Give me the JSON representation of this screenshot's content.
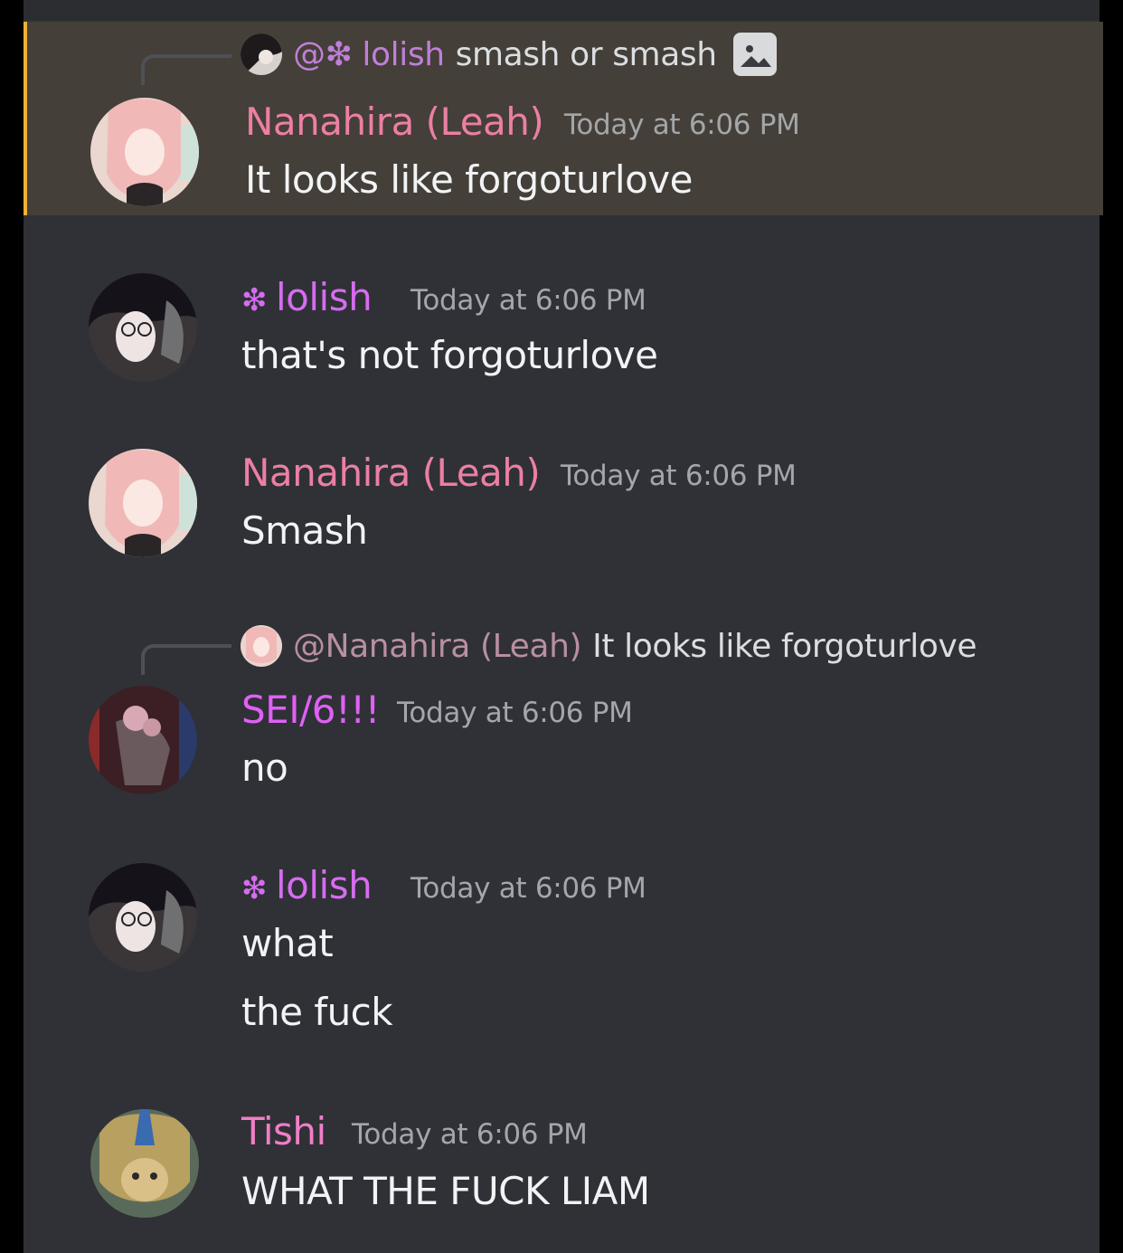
{
  "colors": {
    "background": "#2f3136",
    "highlight": "#443f38",
    "highlight_bar": "#f0b232",
    "nanahira": "#ec7fa3",
    "lolish": "#d66cf0",
    "sei": "#e060f5",
    "tishi": "#f07ec6",
    "timestamp": "#a3a6aa",
    "text": "#f2f3f5"
  },
  "messages": [
    {
      "author": "Nanahira (Leah)",
      "time": "Today at 6:06 PM",
      "text": "It looks like forgoturlove",
      "avatar_icon": "pink-haired-anime-avatar",
      "reply": {
        "mention": "@❇ lolish",
        "text": "smash or smash",
        "icon": "image-attachment-icon"
      }
    },
    {
      "author": "lolish",
      "role_icon": "❇",
      "time": "Today at 6:06 PM",
      "text": "that's not forgoturlove",
      "avatar_icon": "dark-haired-anime-avatar"
    },
    {
      "author": "Nanahira (Leah)",
      "time": "Today at 6:06 PM",
      "text": "Smash",
      "avatar_icon": "pink-haired-anime-avatar"
    },
    {
      "author": "SEI/6!!!",
      "time": "Today at 6:06 PM",
      "text": "no",
      "avatar_icon": "dark-figure-avatar",
      "reply": {
        "mention": "@Nanahira (Leah)",
        "text": "It looks like forgoturlove"
      }
    },
    {
      "author": "lolish",
      "role_icon": "❇",
      "time": "Today at 6:06 PM",
      "text": "what",
      "text2": "the fuck",
      "avatar_icon": "dark-haired-anime-avatar"
    },
    {
      "author": "Tishi",
      "time": "Today at 6:06 PM",
      "text": "WHAT THE FUCK LIAM",
      "avatar_icon": "golden-creature-avatar"
    }
  ]
}
